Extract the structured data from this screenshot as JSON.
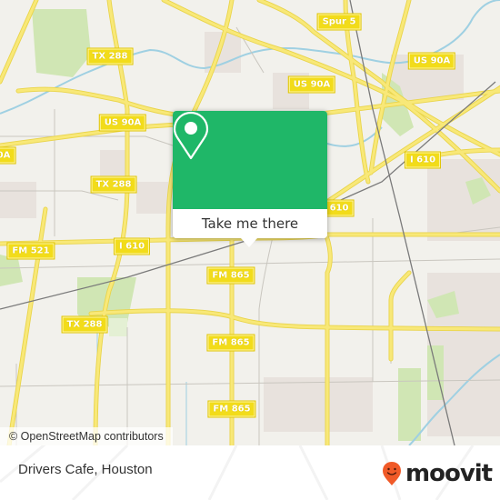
{
  "map": {
    "colors": {
      "background": "#f2f1ec",
      "road_major": "#f7e56b",
      "road_outline": "#e8d24a",
      "park": "#cfe4b0",
      "water": "#a9d3e3",
      "urban": "#e6e0dc",
      "rail": "#777777",
      "minor_road": "#c9c6bf"
    },
    "route_labels": [
      {
        "id": "spur5",
        "text": "Spur 5"
      },
      {
        "id": "tx288-top",
        "text": "TX 288"
      },
      {
        "id": "us90a-right",
        "text": "US 90A"
      },
      {
        "id": "us90a-mid",
        "text": "US 90A"
      },
      {
        "id": "us90a-left",
        "text": "US 90A"
      },
      {
        "id": "us90a-edge",
        "text": "0A"
      },
      {
        "id": "tx288-mid",
        "text": "TX 288"
      },
      {
        "id": "i610-right",
        "text": "I 610"
      },
      {
        "id": "i610-popup",
        "text": "610"
      },
      {
        "id": "fm521",
        "text": "FM 521"
      },
      {
        "id": "i610-left",
        "text": "I 610"
      },
      {
        "id": "fm865-1",
        "text": "FM 865"
      },
      {
        "id": "tx288-bottom",
        "text": "TX 288"
      },
      {
        "id": "fm865-2",
        "text": "FM 865"
      },
      {
        "id": "fm865-3",
        "text": "FM 865"
      }
    ]
  },
  "popup": {
    "icon": "map-pin-icon",
    "button_label": "Take me there",
    "color": "#1fb768"
  },
  "attribution": "© OpenStreetMap contributors",
  "footer": {
    "place_name": "Drivers Cafe, Houston",
    "brand": "moovit",
    "brand_color": "#f05a28"
  }
}
